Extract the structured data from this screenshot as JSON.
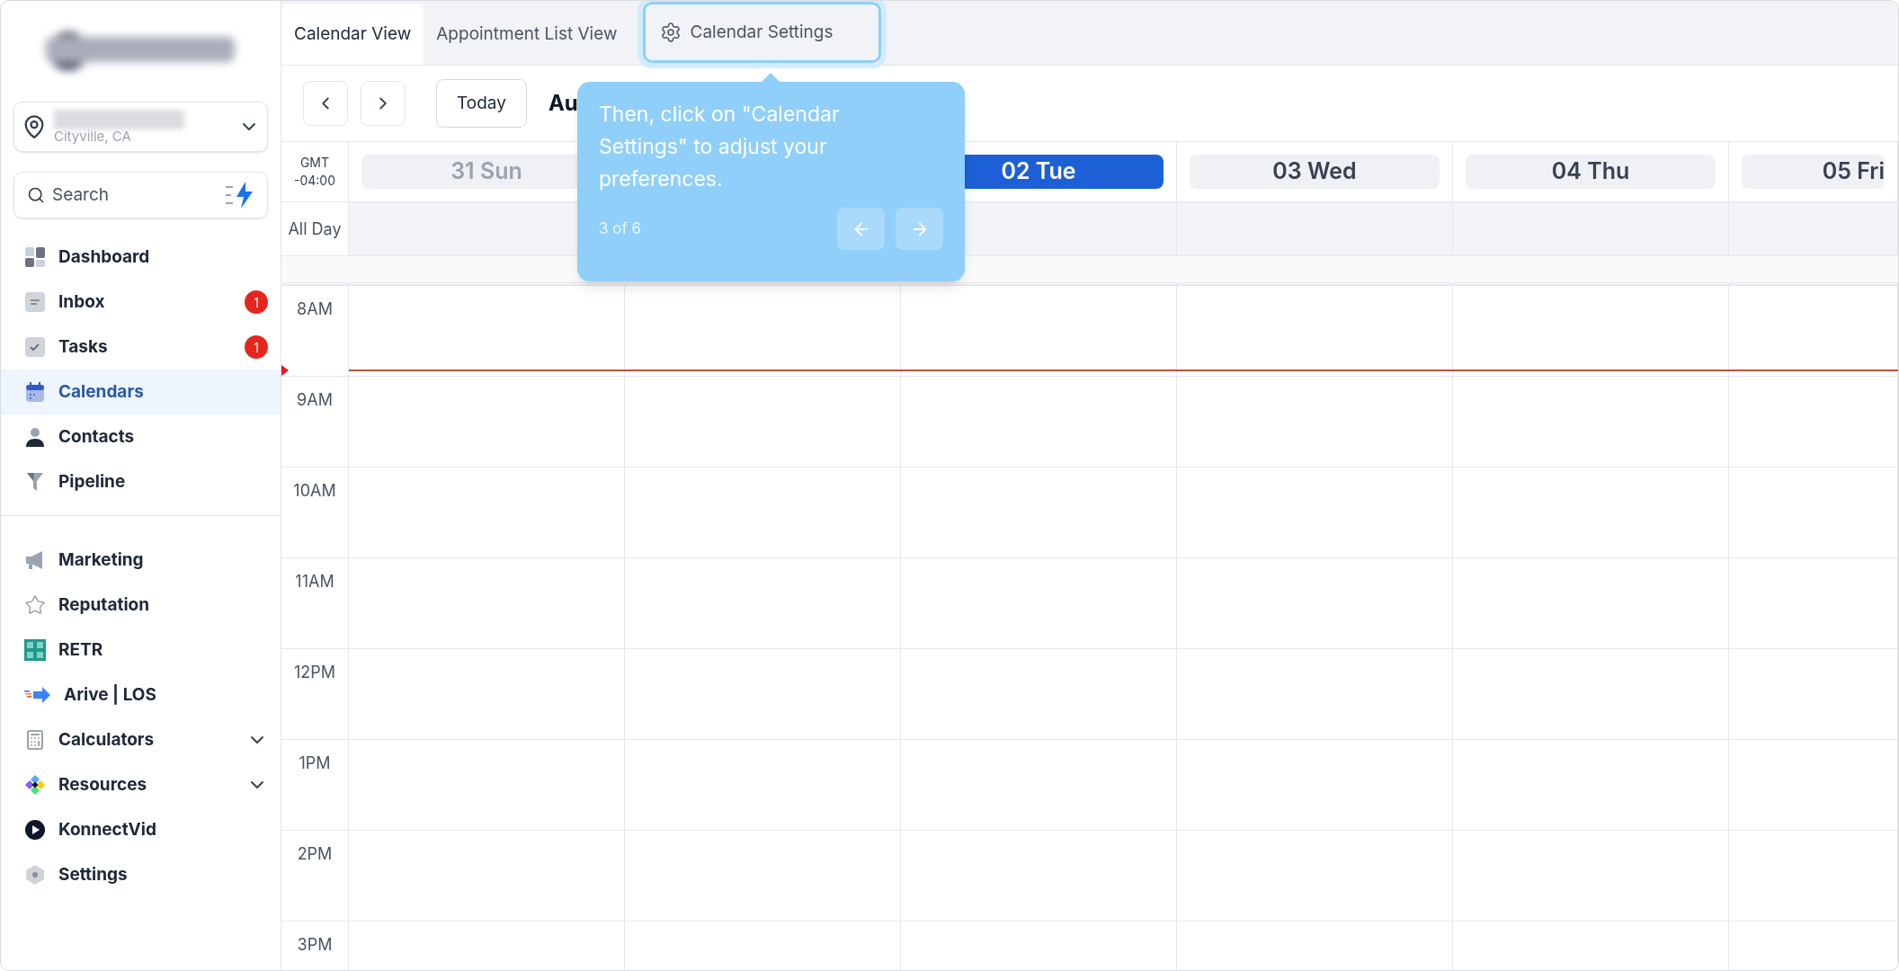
{
  "sidebar": {
    "location": {
      "subtitle": "Cityville, CA"
    },
    "search": {
      "placeholder": "Search"
    },
    "nav_items": [
      {
        "label": "Dashboard",
        "selected": false
      },
      {
        "label": "Inbox",
        "selected": false,
        "badge": "1"
      },
      {
        "label": "Tasks",
        "selected": false,
        "badge": "1"
      },
      {
        "label": "Calendars",
        "selected": true
      },
      {
        "label": "Contacts",
        "selected": false
      },
      {
        "label": "Pipeline",
        "selected": false
      }
    ],
    "more_items": [
      {
        "label": "Marketing",
        "selected": false
      },
      {
        "label": "Reputation",
        "selected": false
      },
      {
        "label": "RETR",
        "selected": false
      },
      {
        "label": "Arive | LOS",
        "selected": false
      },
      {
        "label": "Calculators",
        "selected": false,
        "expanded": false
      },
      {
        "label": "Resources",
        "selected": false,
        "expanded": false
      },
      {
        "label": "KonnectVid",
        "selected": false
      },
      {
        "label": "Settings",
        "selected": false
      }
    ]
  },
  "tabs": [
    {
      "label": "Calendar View",
      "selected": true,
      "kind": "plain"
    },
    {
      "label": "Appointment List View",
      "selected": false,
      "kind": "plain"
    },
    {
      "label": "Calendar Settings",
      "selected": false,
      "kind": "settings",
      "highlighted": true
    }
  ],
  "toolbar": {
    "today_button": "Today",
    "title": "Au"
  },
  "calendar": {
    "timezone": [
      "GMT",
      "-04:00"
    ],
    "all_day_label": "All Day",
    "days": [
      {
        "kind": "day",
        "label": "31 Sun",
        "past": true,
        "selected": false
      },
      {
        "kind": "covered"
      },
      {
        "kind": "day",
        "label": "02 Tue",
        "past": false,
        "selected": true
      },
      {
        "kind": "day",
        "label": "03 Wed",
        "past": false,
        "selected": false
      },
      {
        "kind": "day",
        "label": "04 Thu",
        "past": false,
        "selected": false
      },
      {
        "kind": "day",
        "label": "05 Fri",
        "past": false,
        "selected": false
      }
    ],
    "hours": [
      "8AM",
      "9AM",
      "10AM",
      "11AM",
      "12PM",
      "1PM",
      "2PM",
      "3PM"
    ]
  },
  "tour_tooltip": {
    "text": "Then, click on \"Calendar Settings\" to adjust your preferences.",
    "step": "3 of 6"
  }
}
